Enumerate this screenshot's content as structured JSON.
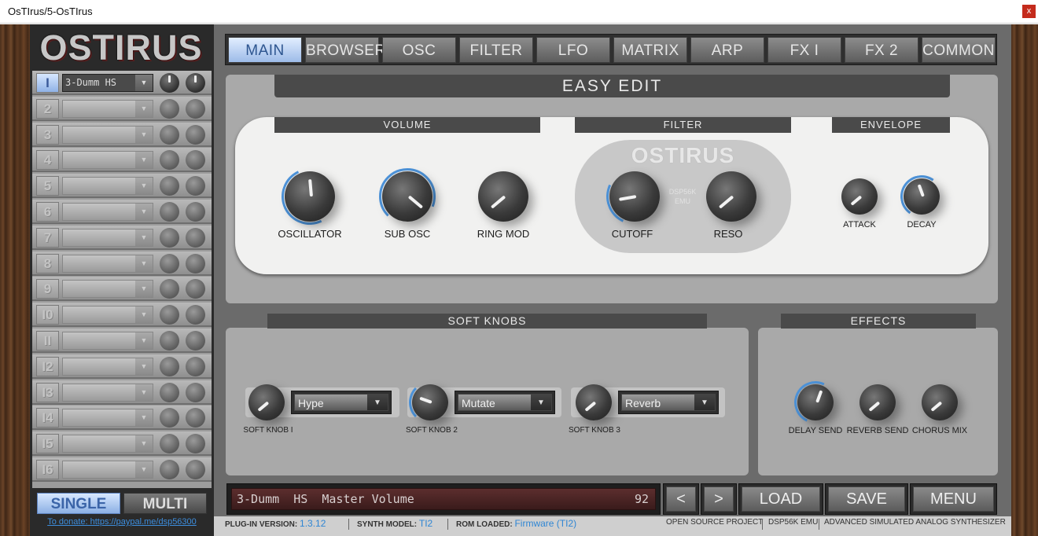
{
  "window": {
    "title": "OsTIrus/5-OsTIrus",
    "close_label": "x"
  },
  "logo": "OSTIRUS",
  "tabs": [
    "MAIN",
    "BROWSER",
    "OSC",
    "FILTER",
    "LFO",
    "MATRIX",
    "ARP",
    "FX I",
    "FX 2",
    "COMMON"
  ],
  "active_tab": "MAIN",
  "parts": [
    {
      "num": "I",
      "preset": "3-Dumm  HS"
    },
    {
      "num": "2",
      "preset": ""
    },
    {
      "num": "3",
      "preset": ""
    },
    {
      "num": "4",
      "preset": ""
    },
    {
      "num": "5",
      "preset": ""
    },
    {
      "num": "6",
      "preset": ""
    },
    {
      "num": "7",
      "preset": ""
    },
    {
      "num": "8",
      "preset": ""
    },
    {
      "num": "9",
      "preset": ""
    },
    {
      "num": "I0",
      "preset": ""
    },
    {
      "num": "II",
      "preset": ""
    },
    {
      "num": "I2",
      "preset": ""
    },
    {
      "num": "I3",
      "preset": ""
    },
    {
      "num": "I4",
      "preset": ""
    },
    {
      "num": "I5",
      "preset": ""
    },
    {
      "num": "I6",
      "preset": ""
    }
  ],
  "modes": {
    "single": "SINGLE",
    "multi": "MULTI",
    "active": "SINGLE"
  },
  "donate": "To donate: https://paypal.me/dsp56300",
  "easy_edit": {
    "title": "EASY EDIT",
    "sections": {
      "volume": "VOLUME",
      "filter": "FILTER",
      "envelope": "ENVELOPE"
    },
    "filter_logo": "OSTIRUS",
    "filter_emu": "DSP56K EMU",
    "knobs": {
      "oscillator": {
        "label": "OSCILLATOR"
      },
      "sub_osc": {
        "label": "SUB OSC"
      },
      "ring_mod": {
        "label": "RING MOD"
      },
      "cutoff": {
        "label": "CUTOFF"
      },
      "reso": {
        "label": "RESO"
      },
      "attack": {
        "label": "ATTACK"
      },
      "decay": {
        "label": "DECAY"
      }
    }
  },
  "soft_knobs": {
    "title": "SOFT KNOBS",
    "items": [
      {
        "label": "SOFT KNOB I",
        "assign": "Hype"
      },
      {
        "label": "SOFT KNOB 2",
        "assign": "Mutate"
      },
      {
        "label": "SOFT KNOB 3",
        "assign": "Reverb"
      }
    ]
  },
  "effects": {
    "title": "EFFECTS",
    "knobs": [
      "DELAY SEND",
      "REVERB SEND",
      "CHORUS MIX"
    ]
  },
  "display": {
    "text": "3-Dumm  HS  Master Volume",
    "value": "92"
  },
  "buttons": {
    "prev": "<",
    "next": ">",
    "load": "LOAD",
    "save": "SAVE",
    "menu": "MENU"
  },
  "status": {
    "plugin_label": "PLUG-IN VERSION:",
    "plugin_version": "1.3.12",
    "synth_label": "SYNTH MODEL:",
    "synth_model": "TI2",
    "rom_label": "ROM LOADED:",
    "rom": "Firmware (TI2)",
    "open_source": "OPEN SOURCE PROJECT",
    "dsp": "DSP56K EMU",
    "tagline": "ADVANCED SIMULATED ANALOG SYNTHESIZER"
  },
  "colors": {
    "accent": "#8fb2e6",
    "arc": "#4d93d9",
    "display_bg": "#4a2222"
  }
}
